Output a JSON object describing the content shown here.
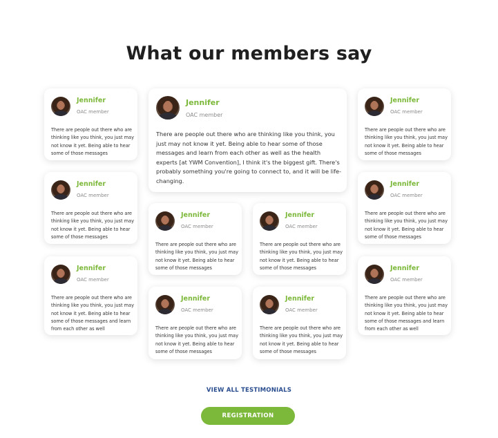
{
  "page": {
    "title": "What our members say"
  },
  "featured": {
    "name": "Jennifer",
    "role": "OAC member",
    "quote": "There are people out there who are thinking like you think, you just may not know it yet. Being able to hear some of those messages and learn from each other as well as the health experts [at YWM Convention], I think it's the biggest gift. There's probably something you're going to connect to, and it will be life-changing."
  },
  "testimonials": [
    {
      "name": "Jennifer",
      "role": "OAC member",
      "quote": "There are people out there who are thinking like you think, you just may not know it yet. Being able to hear some of those messages"
    },
    {
      "name": "Jennifer",
      "role": "OAC member",
      "quote": "There are people out there who are thinking like you think, you just may not know it yet. Being able to hear some of those messages"
    },
    {
      "name": "Jennifer",
      "role": "OAC member",
      "quote": "There are people out there who are thinking like you think, you just may not know it yet. Being able to hear some of those messages and learn from each other as well"
    },
    {
      "name": "Jennifer",
      "role": "OAC member",
      "quote": "There are people out there who are thinking like you think, you just may not know it yet. Being able to hear some of those messages"
    },
    {
      "name": "Jennifer",
      "role": "OAC member",
      "quote": "There are people out there who are thinking like you think, you just may not know it yet. Being able to hear some of those messages"
    },
    {
      "name": "Jennifer",
      "role": "OAC member",
      "quote": "There are people out there who are thinking like you think, you just may not know it yet. Being able to hear some of those messages"
    },
    {
      "name": "Jennifer",
      "role": "OAC member",
      "quote": "There are people out there who are thinking like you think, you just may not know it yet. Being able to hear some of those messages"
    },
    {
      "name": "Jennifer",
      "role": "OAC member",
      "quote": "There are people out there who are thinking like you think, you just may not know it yet. Being able to hear some of those messages"
    },
    {
      "name": "Jennifer",
      "role": "OAC member",
      "quote": "There are people out there who are thinking like you think, you just may not know it yet. Being able to hear some of those messages"
    },
    {
      "name": "Jennifer",
      "role": "OAC member",
      "quote": "There are people out there who are thinking like you think, you just may not know it yet. Being able to hear some of those messages and learn from each other as well"
    }
  ],
  "actions": {
    "view_all_label": "VIEW ALL TESTIMONIALS",
    "registration_label": "REGISTRATION"
  },
  "colors": {
    "accent_green": "#7cb83a",
    "link_blue": "#2a4d8f"
  }
}
